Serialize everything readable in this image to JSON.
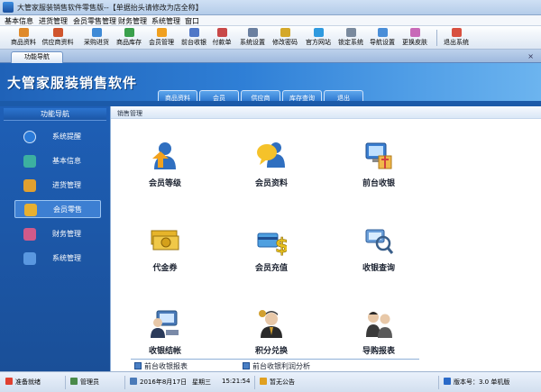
{
  "window": {
    "title": "大管家服装销售软件零售版--【单据抬头请修改为店全称】"
  },
  "menu": [
    "基本信息",
    "进货管理",
    "会员零售管理",
    "财务管理",
    "系统管理",
    "窗口"
  ],
  "toolbar": {
    "items": [
      {
        "label": "商品资料",
        "icon": "product-icon",
        "color": "#e08a2a"
      },
      {
        "label": "供应商资料",
        "icon": "supplier-icon",
        "color": "#d0552d"
      },
      {
        "label": "采购进货",
        "icon": "purchase-icon",
        "color": "#3f8ad6"
      },
      {
        "label": "商品库存",
        "icon": "inventory-icon",
        "color": "#3aa04c"
      },
      {
        "label": "会员管理",
        "icon": "member-icon",
        "color": "#f0a020"
      },
      {
        "label": "前台收银",
        "icon": "cashier-icon",
        "color": "#5078c8"
      },
      {
        "label": "付款单",
        "icon": "payment-icon",
        "color": "#c84848"
      },
      {
        "label": "系统设置",
        "icon": "settings-icon",
        "color": "#6a7fa0"
      },
      {
        "label": "修改密码",
        "icon": "key-icon",
        "color": "#d4a82a"
      },
      {
        "label": "官方网站",
        "icon": "globe-icon",
        "color": "#2f9adf"
      },
      {
        "label": "锁定系统",
        "icon": "lock-icon",
        "color": "#7a8a9e"
      },
      {
        "label": "导航设置",
        "icon": "nav-settings-icon",
        "color": "#4a8ed8"
      },
      {
        "label": "更换皮肤",
        "icon": "skin-icon",
        "color": "#c86ab8"
      },
      {
        "label": "退出系统",
        "icon": "exit-icon",
        "color": "#d85040"
      }
    ]
  },
  "doc_tab": {
    "label": "功能导航",
    "close": "×"
  },
  "banner": {
    "title": "大管家服装销售软件",
    "tabs": [
      "商品资料",
      "会员",
      "供应商",
      "库存查询",
      "退出"
    ]
  },
  "sidebar": {
    "header": "功能导航",
    "items": [
      {
        "label": "系统提醒",
        "icon": "info-icon",
        "color": "#2a7ad8",
        "active": false
      },
      {
        "label": "基本信息",
        "icon": "blocks-icon",
        "color": "#3cb0a0",
        "active": false
      },
      {
        "label": "进货管理",
        "icon": "box-icon",
        "color": "#e0a030",
        "active": false
      },
      {
        "label": "会员零售",
        "icon": "gift-icon",
        "color": "#e8b030",
        "active": true
      },
      {
        "label": "财务管理",
        "icon": "finance-icon",
        "color": "#d05a8a",
        "active": false
      },
      {
        "label": "系统管理",
        "icon": "system-icon",
        "color": "#5a98e0",
        "active": false
      }
    ]
  },
  "content": {
    "title": "销售管理",
    "modules": [
      {
        "label": "会员等级",
        "icon": "member-level-icon",
        "color": "#f2a21e"
      },
      {
        "label": "会员资料",
        "icon": "member-profile-icon",
        "color": "#f5c22a"
      },
      {
        "label": "前台收银",
        "icon": "front-cashier-icon",
        "color": "#3a7ed0"
      },
      {
        "label": "代金券",
        "icon": "voucher-icon",
        "color": "#e6b42a"
      },
      {
        "label": "会员充值",
        "icon": "recharge-icon",
        "color": "#e6c020"
      },
      {
        "label": "收银查询",
        "icon": "cashier-query-icon",
        "color": "#6a9ed8"
      },
      {
        "label": "收银结帐",
        "icon": "checkout-icon",
        "color": "#4a7ab8"
      },
      {
        "label": "积分兑换",
        "icon": "points-exchange-icon",
        "color": "#d2a030"
      },
      {
        "label": "导购报表",
        "icon": "guide-report-icon",
        "color": "#3a3a3a"
      }
    ],
    "links": [
      "前台收银报表",
      "前台收银利润分析"
    ]
  },
  "status": {
    "ready": "准备就绪",
    "user": "管理员",
    "date": "2016年8月17日",
    "weekday": "星期三",
    "time": "15:21:54",
    "notice": "暂无公告",
    "version": "版本号：3.0 单机版"
  }
}
